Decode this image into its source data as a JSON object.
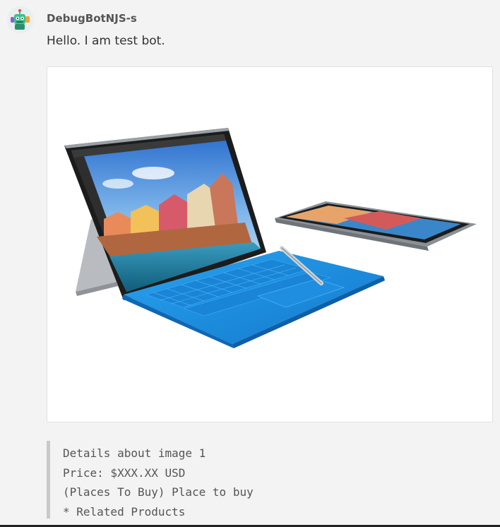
{
  "message": {
    "sender": "DebugBotNJS-s",
    "text": "Hello. I am test bot.",
    "avatar_icon": "robot-avatar-icon",
    "attachment": {
      "type": "image",
      "subject": "tablet-with-keyboard"
    },
    "details_lines": [
      "Details about image 1",
      "Price: $XXX.XX USD",
      "(Places To Buy) Place to buy",
      "* Related Products"
    ]
  },
  "colors": {
    "background": "#f3f3f3",
    "card": "#ffffff",
    "keyboard_blue": "#1e8fe0",
    "quote_bar": "#c9c9c9"
  }
}
